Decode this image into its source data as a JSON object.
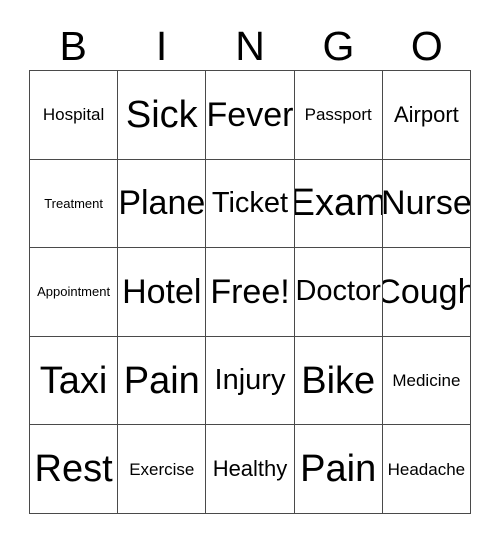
{
  "card": {
    "type": "bingo-card",
    "columns": 5,
    "rows": 5,
    "header_letters": [
      "B",
      "I",
      "N",
      "G",
      "O"
    ],
    "colors": {
      "background": "#ffffff",
      "text": "#000000",
      "gridline": "#4a4a4a"
    },
    "free_space": {
      "label": "Free!",
      "row": 2,
      "column": 2
    },
    "cells": [
      [
        {
          "label": "Hospital"
        },
        {
          "label": "Sick"
        },
        {
          "label": "Fever"
        },
        {
          "label": "Passport"
        },
        {
          "label": "Airport"
        }
      ],
      [
        {
          "label": "Treatment"
        },
        {
          "label": "Plane"
        },
        {
          "label": "Ticket"
        },
        {
          "label": "Exam"
        },
        {
          "label": "Nurse"
        }
      ],
      [
        {
          "label": "Appointment"
        },
        {
          "label": "Hotel"
        },
        {
          "label": "Free!"
        },
        {
          "label": "Doctor"
        },
        {
          "label": "Cough"
        }
      ],
      [
        {
          "label": "Taxi"
        },
        {
          "label": "Pain"
        },
        {
          "label": "Injury"
        },
        {
          "label": "Bike"
        },
        {
          "label": "Medicine"
        }
      ],
      [
        {
          "label": "Rest"
        },
        {
          "label": "Exercise"
        },
        {
          "label": "Healthy"
        },
        {
          "label": "Pain"
        },
        {
          "label": "Headache"
        }
      ]
    ]
  }
}
